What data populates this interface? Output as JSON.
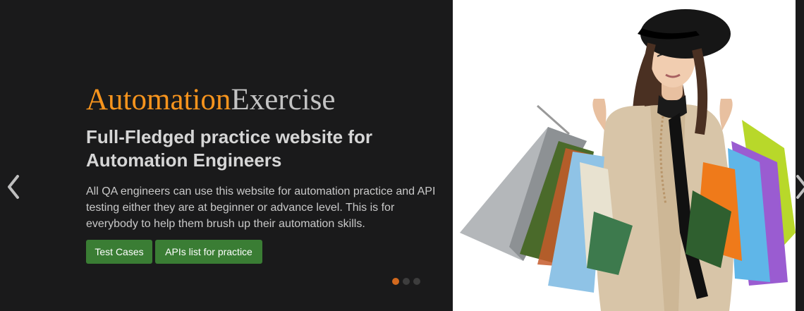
{
  "brand": {
    "part1": "Automation",
    "part2": "Exercise"
  },
  "headline": "Full-Fledged practice website for Automation Engineers",
  "description": "All QA engineers can use this website for automation practice and API testing either they are at beginner or advance level. This is for everybody to help them brush up their automation skills.",
  "buttons": {
    "test_cases": "Test Cases",
    "apis_list": "APIs list for practice"
  },
  "carousel": {
    "active_index": 0,
    "total_slides": 3
  },
  "icons": {
    "prev": "chevron-left-icon",
    "next": "chevron-right-icon"
  },
  "colors": {
    "background": "#1a1a1b",
    "brand_orange": "#f7941d",
    "brand_grey": "#c3c3c3",
    "button_green": "#3a7d34",
    "dot_active": "#d2691e"
  }
}
